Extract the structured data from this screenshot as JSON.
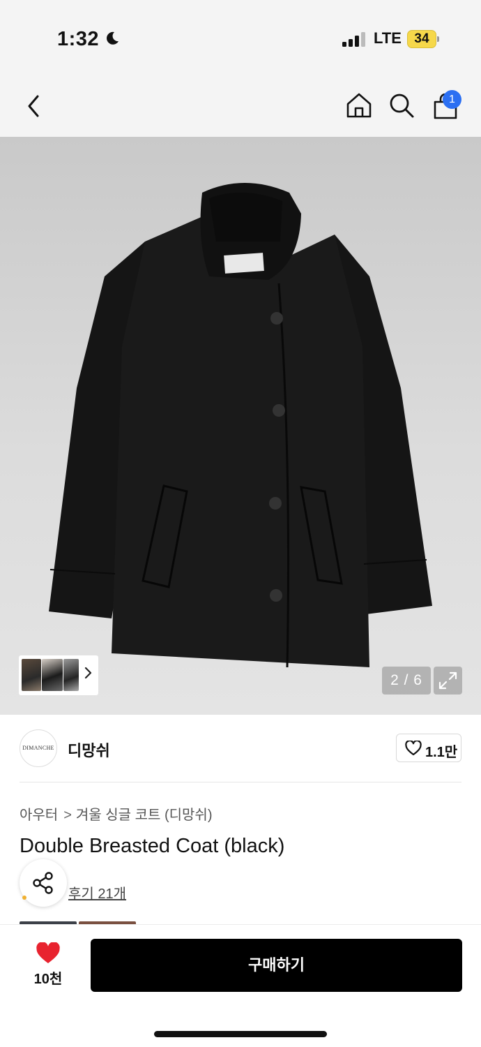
{
  "status_bar": {
    "time": "1:32",
    "network": "LTE",
    "battery": "34",
    "signal_bars_filled": 3,
    "battery_color": "#f6d84a"
  },
  "nav": {
    "back_icon": "chevron-left-icon",
    "home_icon": "home-icon",
    "search_icon": "search-icon",
    "cart_icon": "shopping-bag-icon",
    "cart_count": "1",
    "badge_color": "#2b6ff2"
  },
  "gallery": {
    "counter": "2 / 6",
    "current_image": 2,
    "total_images": 6,
    "expand_icon": "expand-icon",
    "thumb_next_icon": "chevron-right-icon"
  },
  "brand": {
    "logo_text": "DIMANCHE",
    "name": "디망쉬",
    "like_count": "1.1만",
    "like_icon": "heart-outline-icon"
  },
  "product": {
    "breadcrumb": [
      "아우터",
      "겨울 싱글 코트 (디망쉬)"
    ],
    "breadcrumb_separator": ">",
    "title": "Double Breasted Coat (black)",
    "share_icon": "share-icon",
    "reviews": "후기 21개"
  },
  "bottom_bar": {
    "wish_icon": "heart-filled-icon",
    "wish_color": "#e8232f",
    "wish_count": "10천",
    "buy_label": "구매하기",
    "buy_color": "#000000"
  }
}
